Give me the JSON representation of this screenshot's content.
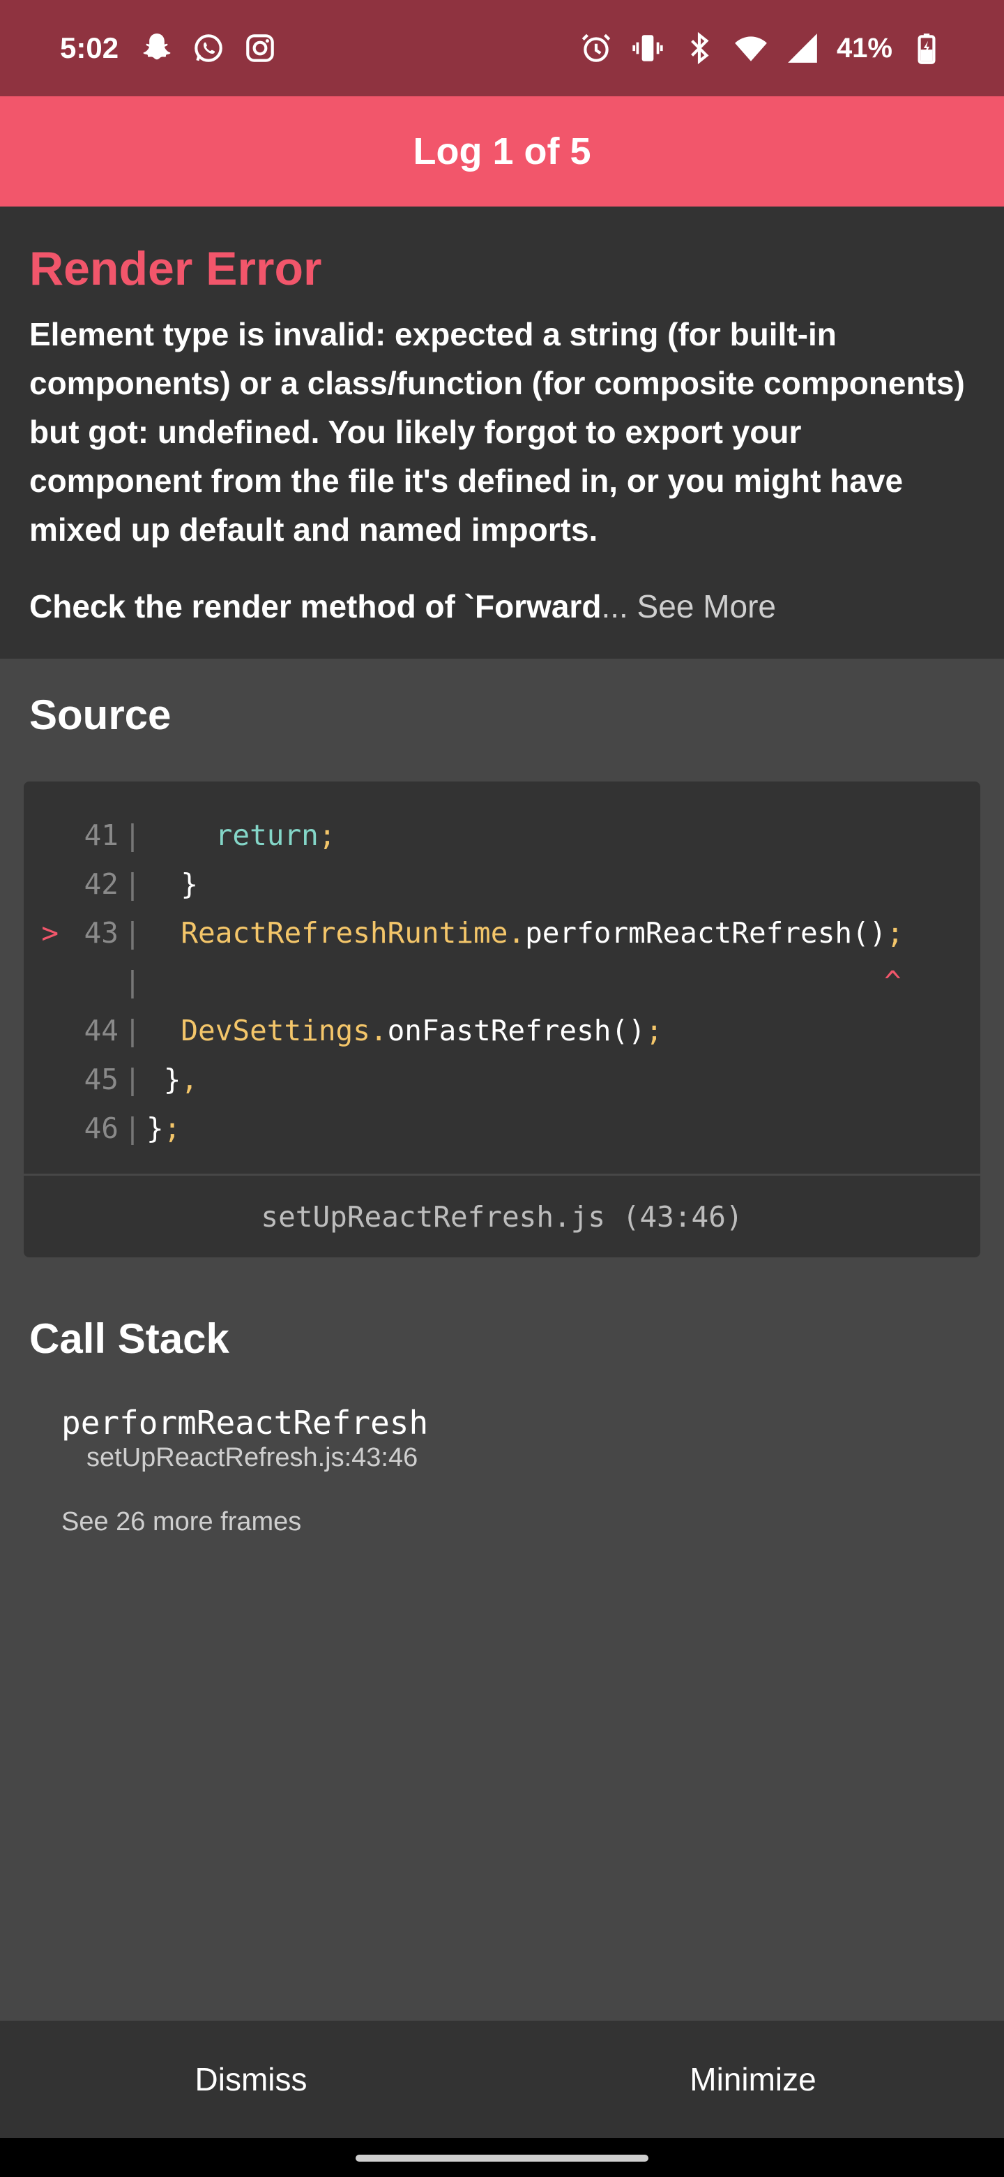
{
  "status_bar": {
    "time": "5:02",
    "battery": "41%",
    "left_icons": [
      "snapchat-icon",
      "whatsapp-icon",
      "instagram-icon"
    ],
    "right_icons": [
      "alarm-icon",
      "vibrate-icon",
      "bluetooth-icon",
      "wifi-icon",
      "signal-icon",
      "battery-charging-icon"
    ]
  },
  "header": {
    "title": "Log 1 of 5"
  },
  "error": {
    "title": "Render Error",
    "message": "Element type is invalid: expected a string (for built-in components) or a class/function (for composite components) but got: undefined. You likely forgot to export your component from the file it's defined in, or you might have mixed up default and named imports.",
    "check_text": "Check the render method of `Forward",
    "ellipsis": "...",
    "see_more": " See More"
  },
  "source": {
    "title": "Source",
    "file": "setUpReactRefresh.js (43:46)",
    "lines": [
      {
        "marker": "",
        "num": "41",
        "indent": "    ",
        "kw": "return",
        "obj": "",
        "plain": "",
        "punc": ";"
      },
      {
        "marker": "",
        "num": "42",
        "indent": "  ",
        "kw": "",
        "obj": "",
        "plain": "}",
        "punc": ""
      },
      {
        "marker": ">",
        "num": "43",
        "indent": "  ",
        "kw": "",
        "obj": "ReactRefreshRuntime.",
        "plain": "performReactRefresh()",
        "punc": ";"
      },
      {
        "marker": "",
        "num": "",
        "indent": "",
        "kw": "",
        "obj": "",
        "plain": "",
        "punc": "",
        "caret": "^"
      },
      {
        "marker": "",
        "num": "44",
        "indent": "  ",
        "kw": "",
        "obj": "DevSettings.",
        "plain": "onFastRefresh()",
        "punc": ";"
      },
      {
        "marker": "",
        "num": "45",
        "indent": " ",
        "kw": "",
        "obj": "",
        "plain": "}",
        "punc": ","
      },
      {
        "marker": "",
        "num": "46",
        "indent": "",
        "kw": "",
        "obj": "",
        "plain": "}",
        "punc": ";"
      }
    ]
  },
  "call_stack": {
    "title": "Call Stack",
    "frame_name": "performReactRefresh",
    "frame_location": "setUpReactRefresh.js:43:46",
    "more_frames": "See 26 more frames"
  },
  "buttons": {
    "dismiss": "Dismiss",
    "minimize": "Minimize"
  },
  "colors": {
    "accent": "#f2566b",
    "status_bar": "#8f3340",
    "panel": "#333333",
    "background": "#474747"
  }
}
